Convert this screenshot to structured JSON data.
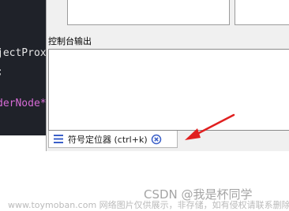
{
  "editor": {
    "lines": [
      {
        "text": "jectProx",
        "color": "#e6e6e6"
      },
      {
        "text": ";",
        "color": "#e6e6e6"
      },
      {
        "text": "derNode*",
        "color": "#d66bd6"
      }
    ]
  },
  "console": {
    "label": "控制台输出"
  },
  "tab": {
    "label": "符号定位器 (ctrl+k)",
    "icon": "list-icon",
    "close_icon": "close-circle-icon",
    "accent": "#3a5fc8"
  },
  "annotation": {
    "arrow_color": "#e02020"
  },
  "watermark": {
    "csdn": "CSDN @我是杯同学",
    "site": "www.toymoban.com 网络图片仅供展示，非存储，如有侵权请联系删除。"
  }
}
